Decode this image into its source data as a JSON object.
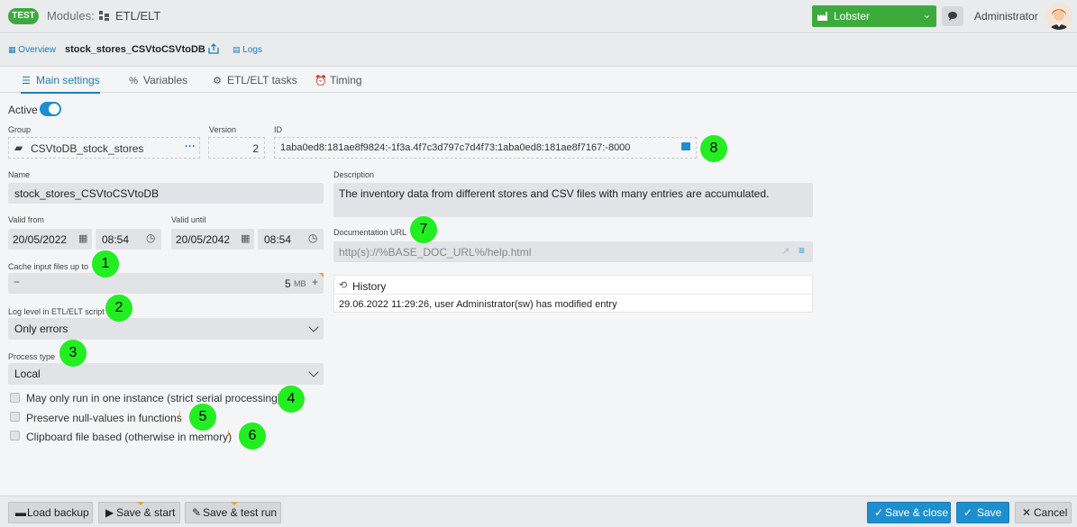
{
  "header": {
    "env_badge": "TEST",
    "modules_label": "Modules:",
    "module_name": "ETL/ELT",
    "tenant": "Lobster",
    "user": "Administrator"
  },
  "subbar": {
    "overview": "Overview",
    "title": "stock_stores_CSVtoCSVtoDB",
    "logs": "Logs"
  },
  "tabs": [
    {
      "label": "Main settings",
      "icon": "list-icon"
    },
    {
      "label": "Variables",
      "icon": "percent-icon"
    },
    {
      "label": "ETL/ELT tasks",
      "icon": "tasks-icon"
    },
    {
      "label": "Timing",
      "icon": "alarm-clock-icon"
    }
  ],
  "form": {
    "active_label": "Active",
    "active": true,
    "group_label": "Group",
    "group_value": "CSVtoDB_stock_stores",
    "version_label": "Version",
    "version_value": "2",
    "id_label": "ID",
    "id_value": "1aba0ed8:181ae8f9824:-1f3a.4f7c3d797c7d4f73:1aba0ed8:181ae8f7167:-8000",
    "name_label": "Name",
    "name_value": "stock_stores_CSVtoCSVtoDB",
    "valid_from_label": "Valid from",
    "valid_from_date": "20/05/2022",
    "valid_from_time": "08:54",
    "valid_until_label": "Valid until",
    "valid_until_date": "20/05/2042",
    "valid_until_time": "08:54",
    "cache_label": "Cache input files up to",
    "cache_minus": "−",
    "cache_value": "5",
    "cache_unit": "MB",
    "cache_plus": "+",
    "loglevel_label": "Log level in ETL/ELT script",
    "loglevel_value": "Only errors",
    "process_label": "Process type",
    "process_value": "Local",
    "cb_serial": "May only run in one instance (strict serial processing)",
    "cb_null": "Preserve null-values in functions",
    "cb_clipboard": "Clipboard file based (otherwise in memory)",
    "info_mark": "i",
    "description_label": "Description",
    "description_value": "The inventory data from different stores and CSV files with many entries are accumulated.",
    "docurl_label": "Documentation URL",
    "docurl_placeholder": "http(s)://%BASE_DOC_URL%/help.html"
  },
  "history": {
    "title": "History",
    "entry": "29.06.2022 11:29:26, user Administrator(sw) has modified entry"
  },
  "badges": [
    "1",
    "2",
    "3",
    "4",
    "5",
    "6",
    "7",
    "8"
  ],
  "footer": {
    "load_backup": "Load backup",
    "save_start": "Save & start",
    "save_test_run": "Save & test run",
    "save_close": "Save & close",
    "save": "Save",
    "cancel": "Cancel"
  },
  "colors": {
    "accent_blue": "#1d8fcf",
    "brand_green": "#3cab3c",
    "annotation_green": "#22ee22",
    "info_orange": "#e8a23a"
  }
}
